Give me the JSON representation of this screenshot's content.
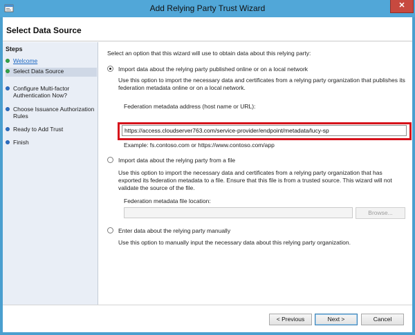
{
  "window": {
    "title": "Add Relying Party Trust Wizard",
    "close_label": "✕",
    "accent_color": "#51a7d8"
  },
  "header": {
    "page_title": "Select Data Source"
  },
  "steps": {
    "title": "Steps",
    "items": [
      {
        "label": "Welcome",
        "status": "completed",
        "icon": "green-dot-icon"
      },
      {
        "label": "Select Data Source",
        "status": "current",
        "icon": "green-dot-icon"
      },
      {
        "label": "Configure Multi-factor Authentication Now?",
        "status": "pending",
        "icon": "blue-dot-icon"
      },
      {
        "label": "Choose Issuance Authorization Rules",
        "status": "pending",
        "icon": "blue-dot-icon"
      },
      {
        "label": "Ready to Add Trust",
        "status": "pending",
        "icon": "blue-dot-icon"
      },
      {
        "label": "Finish",
        "status": "pending",
        "icon": "blue-dot-icon"
      }
    ]
  },
  "main": {
    "intro": "Select an option that this wizard will use to obtain data about this relying party:",
    "option_online": {
      "label": "Import data about the relying party published online or on a local network",
      "selected": true,
      "description": "Use this option to import the necessary data and certificates from a relying party organization that publishes its federation metadata online or on a local network.",
      "field_label": "Federation metadata address (host name or URL):",
      "field_value": "https://access.cloudserver763.com/service-provider/endpoint/metadata/lucy-sp",
      "example": "Example: fs.contoso.com or https://www.contoso.com/app"
    },
    "option_file": {
      "label": "Import data about the relying party from a file",
      "selected": false,
      "description": "Use this option to import the necessary data and certificates from a relying party organization that has exported its federation metadata to a file. Ensure that this file is from a trusted source.  This wizard will not validate the source of the file.",
      "field_label": "Federation metadata file location:",
      "field_value": "",
      "browse_label": "Browse..."
    },
    "option_manual": {
      "label": "Enter data about the relying party manually",
      "selected": false,
      "description": "Use this option to manually input the necessary data about this relying party organization."
    },
    "highlight_color": "#d6101a"
  },
  "footer": {
    "previous_label": "< Previous",
    "next_label": "Next >",
    "cancel_label": "Cancel"
  }
}
